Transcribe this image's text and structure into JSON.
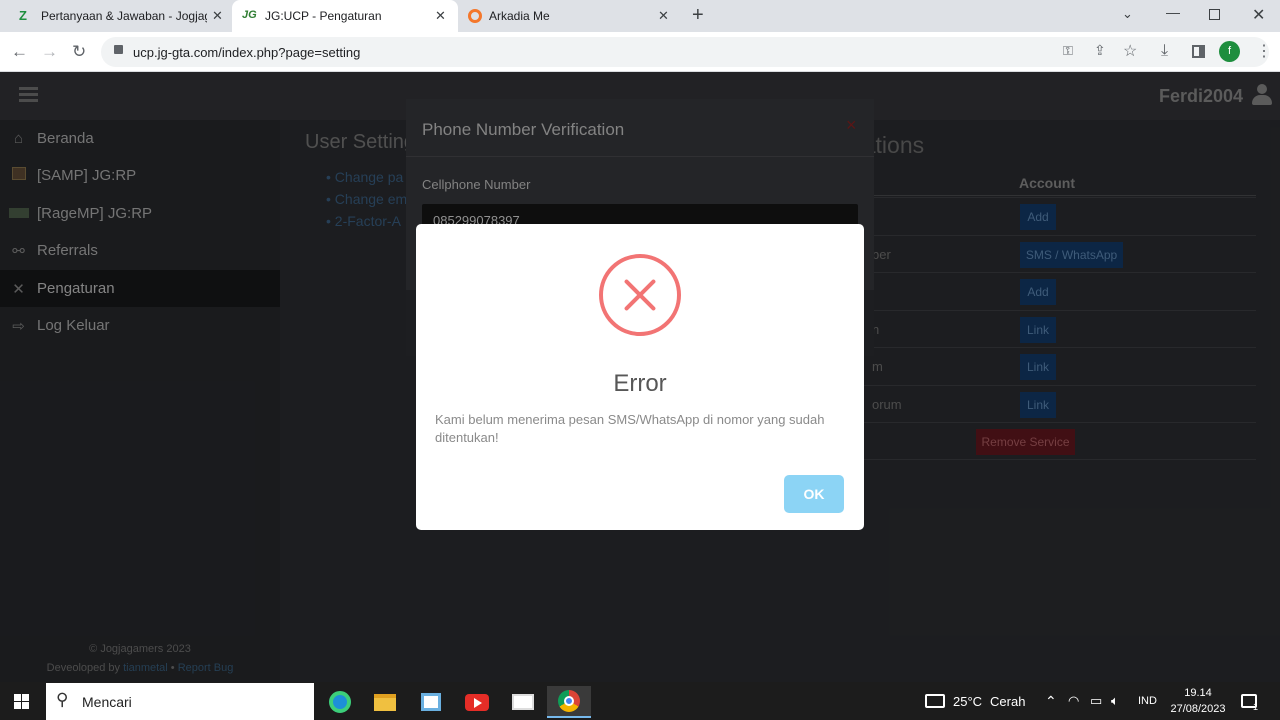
{
  "browser": {
    "tabs": [
      {
        "title": "Pertanyaan & Jawaban - Jogjagan",
        "icon": "brainly-icon",
        "active": false
      },
      {
        "title": "JG:UCP - Pengaturan",
        "icon": "jg-icon",
        "active": true
      },
      {
        "title": "Arkadia Me",
        "icon": "arkadia-icon",
        "active": false
      }
    ],
    "url": "ucp.jg-gta.com/index.php?page=setting",
    "profile_initial": "f",
    "colors": {
      "tabbar": "#dee1e6",
      "profile": "#1e8e3e"
    }
  },
  "site": {
    "username": "Ferdi2004",
    "sidebar": [
      {
        "label": "Beranda",
        "icon": "home-icon"
      },
      {
        "label": "[SAMP] JG:RP",
        "icon": "samp-icon"
      },
      {
        "label": "[RageMP] JG:RP",
        "icon": "ragemp-icon"
      },
      {
        "label": "Referrals",
        "icon": "referrals-icon"
      },
      {
        "label": "Pengaturan",
        "icon": "tools-icon",
        "active": true
      },
      {
        "label": "Log Keluar",
        "icon": "logout-icon"
      }
    ],
    "footer": {
      "copyright": "© Jogjagamers 2023",
      "developed_prefix": "Deveoloped by ",
      "developer": "tianmetal",
      "separator": " • ",
      "report": "Report Bug"
    },
    "user_settings": {
      "title": "User Settings",
      "links": [
        "Change pa",
        "Change em",
        "2-Factor-A"
      ]
    },
    "associations": {
      "title": "Associations",
      "column_account": "Account",
      "rows": [
        {
          "service": "",
          "button": "Add"
        },
        {
          "service": "ber",
          "button": "SMS / WhatsApp"
        },
        {
          "service": "",
          "button": "Add"
        },
        {
          "service": "n",
          "button": "Link"
        },
        {
          "service": "m",
          "button": "Link"
        },
        {
          "service": "orum",
          "button": "Link"
        },
        {
          "service": "",
          "button": "Remove Service"
        }
      ]
    },
    "verify_modal": {
      "title": "Phone Number Verification",
      "close": "×",
      "field_label": "Cellphone Number",
      "field_value": "085299078397"
    },
    "error_dialog": {
      "title": "Error",
      "message": "Kami belum menerima pesan SMS/WhatsApp di nomor yang sudah ditentukan!",
      "ok": "OK",
      "colors": {
        "icon": "#f27474",
        "ok_button": "#8cd4f5"
      }
    }
  },
  "taskbar": {
    "search_placeholder": "Mencari",
    "weather_temp": "25°C",
    "weather_text": "Cerah",
    "language": "IND",
    "time": "19.14",
    "date": "27/08/2023",
    "notification_count": "1"
  }
}
